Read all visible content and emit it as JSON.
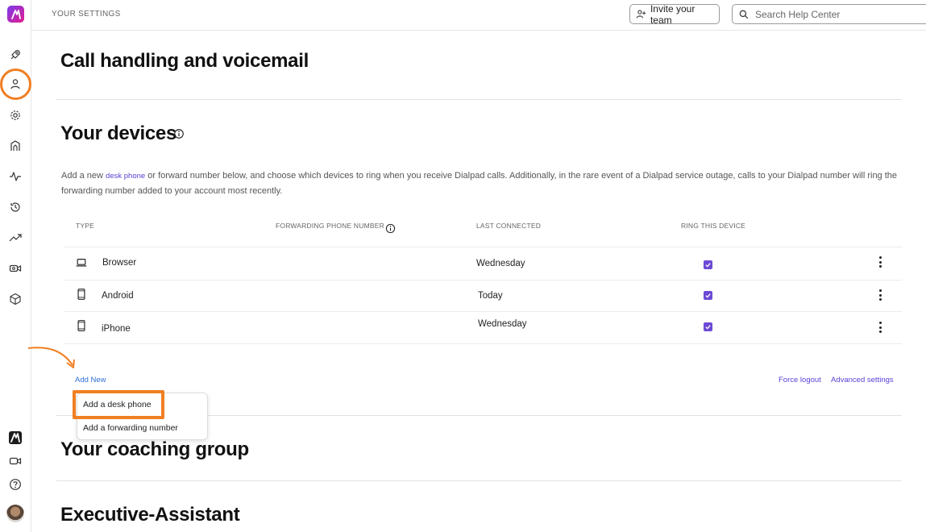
{
  "header": {
    "breadcrumb": "YOUR SETTINGS",
    "invite_label": "Invite your team",
    "search_placeholder": "Search Help Center"
  },
  "sidebar": {
    "items": [
      {
        "icon": "rocket-icon"
      },
      {
        "icon": "user-icon",
        "active": true
      },
      {
        "icon": "gear-icon"
      },
      {
        "icon": "contact-center-icon"
      },
      {
        "icon": "activity-icon"
      },
      {
        "icon": "history-icon"
      },
      {
        "icon": "trending-icon"
      },
      {
        "icon": "video-settings-icon"
      },
      {
        "icon": "box-icon"
      }
    ],
    "bottom": [
      {
        "icon": "dialpad-logo-icon"
      },
      {
        "icon": "video-icon"
      },
      {
        "icon": "help-icon"
      },
      {
        "icon": "avatar"
      }
    ]
  },
  "page": {
    "title": "Call handling and voicemail"
  },
  "devices": {
    "title": "Your devices",
    "desc_prefix": "Add a new ",
    "desc_link": "desk phone",
    "desc_suffix": " or forward number below, and choose which devices to ring when you receive Dialpad calls. Additionally, in the rare event of a Dialpad service outage, calls to your Dialpad number will ring the forwarding number added to your account most recently.",
    "columns": {
      "type": "TYPE",
      "forwarding": "FORWARDING PHONE NUMBER",
      "last_connected": "LAST CONNECTED",
      "ring": "RING THIS DEVICE"
    },
    "rows": [
      {
        "type": "Browser",
        "icon": "laptop-icon",
        "last_connected": "Wednesday",
        "ring": true
      },
      {
        "type": "Android",
        "icon": "mobile-icon",
        "last_connected": "Today",
        "ring": true
      },
      {
        "type": "iPhone",
        "icon": "mobile-icon",
        "last_connected": "Wednesday",
        "ring": true
      }
    ],
    "add_new": "Add New",
    "force_logout": "Force logout",
    "advanced_settings": "Advanced settings",
    "menu": {
      "desk_phone": "Add a desk phone",
      "forwarding": "Add a forwarding number"
    }
  },
  "coaching": {
    "title": "Your coaching group"
  },
  "executive": {
    "title": "Executive-Assistant"
  },
  "colors": {
    "accent": "#6c4ad6",
    "highlight": "#f07f23",
    "link": "#2f6fd6"
  }
}
